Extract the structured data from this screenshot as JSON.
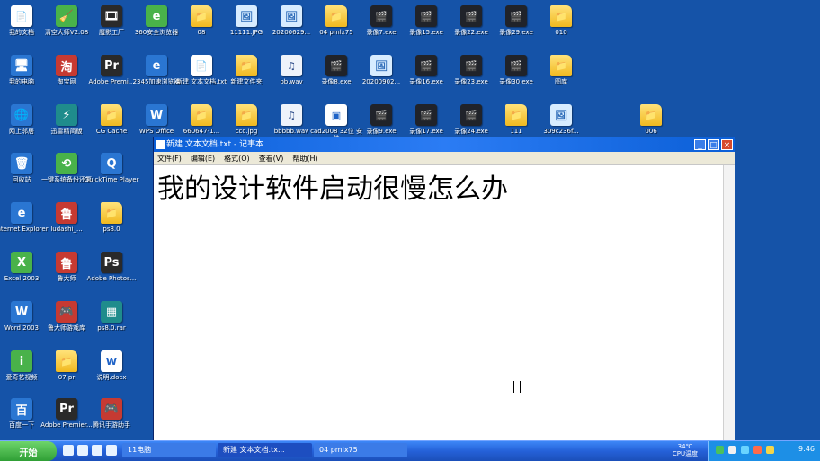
{
  "desktop_icons": [
    {
      "label": "我的文档",
      "icon": "my-documents-icon",
      "glyph": "📄",
      "kind": "doc"
    },
    {
      "label": "清空大师V2.08",
      "icon": "cleaner-icon",
      "glyph": "🧹",
      "kind": "green"
    },
    {
      "label": "魔影工厂",
      "icon": "video-factory-icon",
      "glyph": "🎞",
      "kind": "dark"
    },
    {
      "label": "360安全浏览器",
      "icon": "browser-icon",
      "glyph": "e",
      "kind": "green"
    },
    {
      "label": "08",
      "icon": "folder-icon",
      "glyph": "📁",
      "kind": "folder"
    },
    {
      "label": "11111.JPG",
      "icon": "image-icon",
      "glyph": "🖼",
      "kind": "img"
    },
    {
      "label": "20200629...",
      "icon": "image-icon",
      "glyph": "🖼",
      "kind": "img"
    },
    {
      "label": "04 pmlx75",
      "icon": "folder-icon",
      "glyph": "📁",
      "kind": "folder"
    },
    {
      "label": "录像7.exe",
      "icon": "video-icon",
      "glyph": "🎬",
      "kind": "video"
    },
    {
      "label": "录像15.exe",
      "icon": "video-icon",
      "glyph": "🎬",
      "kind": "video"
    },
    {
      "label": "录像22.exe",
      "icon": "video-icon",
      "glyph": "🎬",
      "kind": "video"
    },
    {
      "label": "录像29.exe",
      "icon": "video-icon",
      "glyph": "🎬",
      "kind": "video"
    },
    {
      "label": "010",
      "icon": "folder-icon",
      "glyph": "📁",
      "kind": "folder"
    },
    {
      "label": "我的电脑",
      "icon": "computer-icon",
      "glyph": "🖥",
      "kind": "blue"
    },
    {
      "label": "淘宝网",
      "icon": "taobao-icon",
      "glyph": "淘",
      "kind": "app"
    },
    {
      "label": "Adobe Premi...",
      "icon": "adobe-premiere-icon",
      "glyph": "Pr",
      "kind": "dark"
    },
    {
      "label": "2345加速浏览器",
      "icon": "browser2-icon",
      "glyph": "e",
      "kind": "blue"
    },
    {
      "label": "新建 文本文档.txt",
      "icon": "text-file-icon",
      "glyph": "📄",
      "kind": "doc"
    },
    {
      "label": "新建文件夹",
      "icon": "folder-icon",
      "glyph": "📁",
      "kind": "folder"
    },
    {
      "label": "bb.wav",
      "icon": "audio-file-icon",
      "glyph": "♫",
      "kind": "wav"
    },
    {
      "label": "录像8.exe",
      "icon": "video-icon",
      "glyph": "🎬",
      "kind": "video"
    },
    {
      "label": "20200902...",
      "icon": "image-icon",
      "glyph": "🖼",
      "kind": "img"
    },
    {
      "label": "录像16.exe",
      "icon": "video-icon",
      "glyph": "🎬",
      "kind": "video"
    },
    {
      "label": "录像23.exe",
      "icon": "video-icon",
      "glyph": "🎬",
      "kind": "video"
    },
    {
      "label": "录像30.exe",
      "icon": "video-icon",
      "glyph": "🎬",
      "kind": "video"
    },
    {
      "label": "图库",
      "icon": "folder-icon",
      "glyph": "📁",
      "kind": "folder"
    },
    {
      "label": "网上邻居",
      "icon": "network-icon",
      "glyph": "🌐",
      "kind": "blue"
    },
    {
      "label": "迅雷精简版",
      "icon": "thunder-icon",
      "glyph": "⚡",
      "kind": "teal"
    },
    {
      "label": "CG Cache",
      "icon": "folder-icon",
      "glyph": "📁",
      "kind": "folder"
    },
    {
      "label": "WPS Office",
      "icon": "wps-icon",
      "glyph": "W",
      "kind": "blue"
    },
    {
      "label": "660647-1...",
      "icon": "folder-icon",
      "glyph": "📁",
      "kind": "folder"
    },
    {
      "label": "ccc.jpg",
      "icon": "folder-icon",
      "glyph": "📁",
      "kind": "folder"
    },
    {
      "label": "bbbbb.wav",
      "icon": "audio-file-icon",
      "glyph": "♫",
      "kind": "wav"
    },
    {
      "label": "cad2008 32位 安装",
      "icon": "installer-icon",
      "glyph": "▣",
      "kind": "doc"
    },
    {
      "label": "录像9.exe",
      "icon": "video-icon",
      "glyph": "🎬",
      "kind": "video"
    },
    {
      "label": "录像17.exe",
      "icon": "video-icon",
      "glyph": "🎬",
      "kind": "video"
    },
    {
      "label": "录像24.exe",
      "icon": "video-icon",
      "glyph": "🎬",
      "kind": "video"
    },
    {
      "label": "111",
      "icon": "folder-icon",
      "glyph": "📁",
      "kind": "folder"
    },
    {
      "label": "309c236f...",
      "icon": "image-icon",
      "glyph": "🖼",
      "kind": "img"
    },
    {
      "label": "006",
      "icon": "folder-icon",
      "glyph": "📁",
      "kind": "folder"
    },
    {
      "label": "回收站",
      "icon": "recycle-bin-icon",
      "glyph": "🗑",
      "kind": "blue"
    },
    {
      "label": "一键系统备份还原",
      "icon": "backup-icon",
      "glyph": "⟲",
      "kind": "green"
    },
    {
      "label": "QuickTime Player",
      "icon": "quicktime-icon",
      "glyph": "Q",
      "kind": "blue"
    },
    {
      "label": "Internet Explorer",
      "icon": "ie-icon",
      "glyph": "e",
      "kind": "blue"
    },
    {
      "label": "ludashi_...",
      "icon": "ludashi-icon",
      "glyph": "鲁",
      "kind": "app"
    },
    {
      "label": "ps8.0",
      "icon": "folder-icon",
      "glyph": "📁",
      "kind": "folder"
    },
    {
      "label": "Excel 2003",
      "icon": "excel-icon",
      "glyph": "X",
      "kind": "green"
    },
    {
      "label": "鲁大师",
      "icon": "ludashi-icon",
      "glyph": "鲁",
      "kind": "app"
    },
    {
      "label": "Adobe Photos...",
      "icon": "photoshop-icon",
      "glyph": "Ps",
      "kind": "dark"
    },
    {
      "label": "Word 2003",
      "icon": "word-icon",
      "glyph": "W",
      "kind": "blue"
    },
    {
      "label": "鲁大师游戏库",
      "icon": "game-library-icon",
      "glyph": "🎮",
      "kind": "app"
    },
    {
      "label": "ps8.0.rar",
      "icon": "rar-icon",
      "glyph": "▦",
      "kind": "teal"
    },
    {
      "label": "爱奇艺视频",
      "icon": "iqiyi-icon",
      "glyph": "i",
      "kind": "green"
    },
    {
      "label": "07 pr",
      "icon": "folder-icon",
      "glyph": "📁",
      "kind": "folder"
    },
    {
      "label": "说明.docx",
      "icon": "doc-file-icon",
      "glyph": "W",
      "kind": "doc"
    },
    {
      "label": "百度一下",
      "icon": "baidu-icon",
      "glyph": "百",
      "kind": "blue"
    },
    {
      "label": "Adobe Premier...",
      "icon": "adobe-premiere-icon",
      "glyph": "Pr",
      "kind": "dark"
    },
    {
      "label": "腾讯手游助手",
      "icon": "tencent-game-icon",
      "glyph": "🎮",
      "kind": "app"
    }
  ],
  "notepad": {
    "title": "新建 文本文档.txt - 记事本",
    "menus": [
      "文件(F)",
      "编辑(E)",
      "格式(O)",
      "查看(V)",
      "帮助(H)"
    ],
    "content": "我的设计软件启动很慢怎么办"
  },
  "taskbar": {
    "start_label": "开始",
    "tasks": [
      "11电脑",
      "新建 文本文档.tx...",
      "04 pmlx75"
    ],
    "status_temp": "34℃",
    "status_label": "CPU温度",
    "clock": "9:46"
  }
}
